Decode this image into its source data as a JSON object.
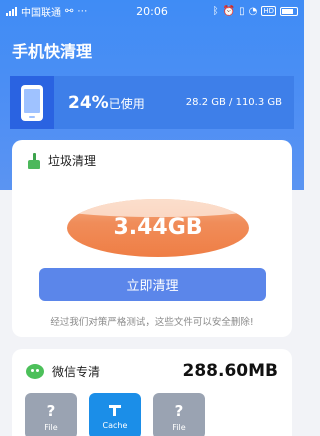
{
  "status": {
    "carrier": "中国联通",
    "time": "20:06",
    "network_badge": "HD"
  },
  "app": {
    "title": "手机快清理"
  },
  "storage": {
    "percent": "24%",
    "used_label": "已使用",
    "capacity": "28.2 GB / 110.3 GB"
  },
  "junk": {
    "title": "垃圾清理",
    "size": "3.44GB",
    "button": "立即清理",
    "hint": "经过我们对策严格测试，这些文件可以安全删除!"
  },
  "wechat": {
    "title": "微信专清",
    "size": "288.60MB",
    "tiles": [
      {
        "symbol": "?",
        "label": "File"
      },
      {
        "symbol": "",
        "label": "Cache"
      },
      {
        "symbol": "?",
        "label": "File"
      }
    ]
  },
  "colors": {
    "primary": "#4f8ff4",
    "accent": "#ef7e45",
    "button": "#5b86ea",
    "wechat": "#4cc05a"
  }
}
